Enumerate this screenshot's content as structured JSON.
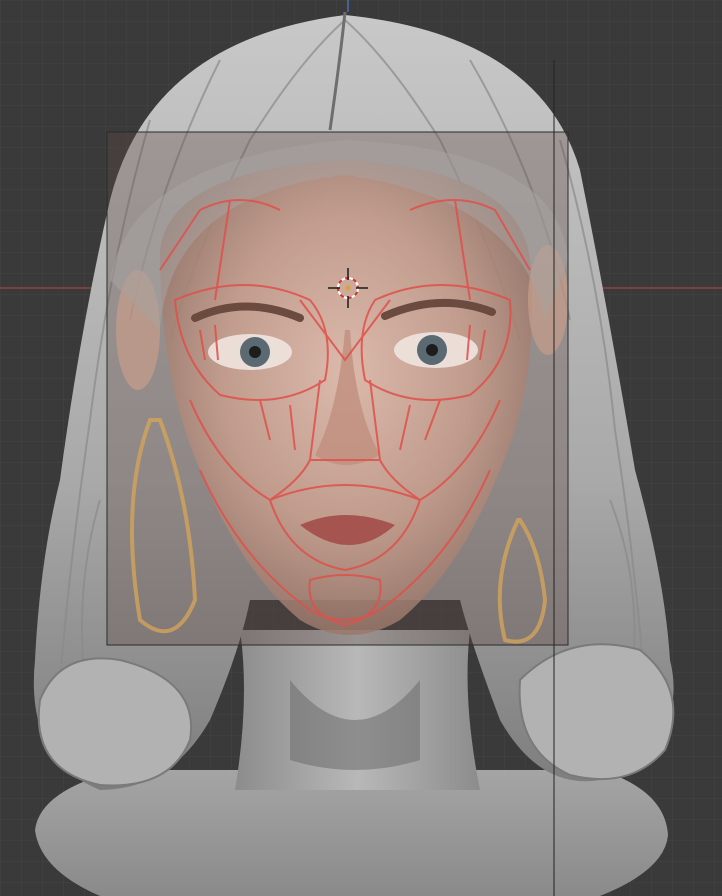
{
  "viewport": {
    "mode": "3d-viewport",
    "background_color": "#3a3a3a",
    "grid_color": "#444444",
    "grid_major_color": "#4c4c4c",
    "x_axis_color": "#b34a4a",
    "z_axis_color": "#4a6fb3"
  },
  "scene": {
    "objects": [
      {
        "name": "sculpted-head-bust",
        "material_color": "#9a9a9a",
        "kind": "mesh"
      },
      {
        "name": "reference-image-plane",
        "kind": "image-empty",
        "opacity": 0.75
      },
      {
        "name": "face-topology-guide",
        "kind": "overlay",
        "line_color": "#e0504a"
      }
    ],
    "cursor": {
      "name": "3d-cursor",
      "ring_colors": [
        "#ffffff",
        "#d6332b"
      ]
    }
  }
}
